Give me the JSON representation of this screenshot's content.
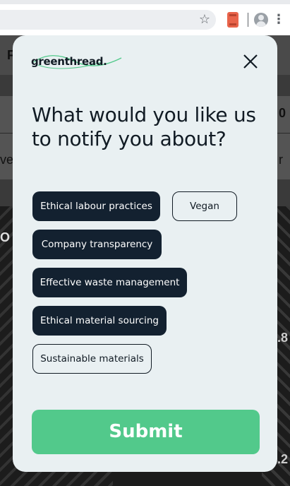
{
  "browser": {
    "star_icon": "star-icon",
    "extension_icon": "extension-icon",
    "profile_icon": "profile-icon",
    "menu_icon": "kebab-menu-icon",
    "star_glyph": "☆",
    "menu_glyph": "⋮"
  },
  "background_peek": {
    "t1": "F",
    "t2": "0",
    "t3": "vel",
    "t4": "r",
    "t5": "O",
    "t6": ".8",
    "t7": ".2"
  },
  "modal": {
    "logo_text": "greenthread.",
    "close_glyph": "✕",
    "heading": "What would you like us to notify you about?",
    "options": [
      {
        "label": "Ethical labour practices",
        "selected": true
      },
      {
        "label": "Vegan",
        "selected": false
      },
      {
        "label": "Company transparency",
        "selected": true
      },
      {
        "label": "Effective waste management",
        "selected": true
      },
      {
        "label": "Ethical material sourcing",
        "selected": true
      },
      {
        "label": "Sustainable materials",
        "selected": false
      }
    ],
    "submit_label": "Submit"
  },
  "colors": {
    "modal_bg": "#e9f0f2",
    "chip_selected": "#132130",
    "submit": "#52c98b",
    "logo_accent": "#52c98b"
  }
}
